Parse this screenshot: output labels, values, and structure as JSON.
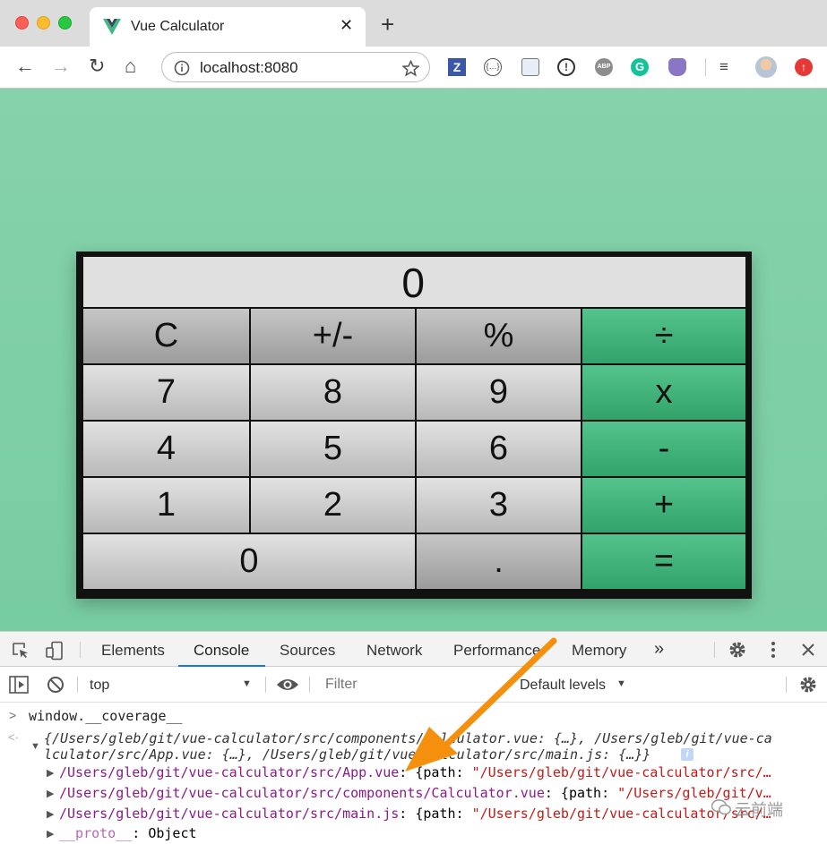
{
  "browser": {
    "tab_title": "Vue Calculator",
    "tab_close": "✕",
    "new_tab": "+",
    "url": "localhost:8080",
    "nav": {
      "back": "←",
      "forward": "→",
      "reload": "↻",
      "home": "⌂"
    },
    "extensions": [
      "z-extension-icon",
      "json-viewer-icon",
      "screenshot-icon",
      "info-icon",
      "adblock-icon",
      "grammarly-icon",
      "cat-extension-icon",
      "playlist-icon",
      "profile-avatar",
      "update-icon"
    ]
  },
  "calculator": {
    "display": "0",
    "rows": [
      [
        "C",
        "+/-",
        "%",
        "÷"
      ],
      [
        "7",
        "8",
        "9",
        "x"
      ],
      [
        "4",
        "5",
        "6",
        "-"
      ],
      [
        "1",
        "2",
        "3",
        "+"
      ],
      [
        "0",
        ".",
        "="
      ]
    ]
  },
  "devtools": {
    "tabs": [
      "Elements",
      "Console",
      "Sources",
      "Network",
      "Performance",
      "Memory"
    ],
    "more": "»",
    "context": "top",
    "filter_placeholder": "Filter",
    "levels": "Default levels",
    "console": {
      "input": "window.__coverage__",
      "summary_line1": "{/Users/gleb/git/vue-calculator/src/components/Calculator.vue: {…}, /Users/gleb/git/vue-ca",
      "summary_line2": "lculator/src/App.vue: {…}, /Users/gleb/git/vue-calculator/src/main.js: {…}}",
      "info_badge": "i",
      "entries": [
        {
          "key": "/Users/gleb/git/vue-calculator/src/App.vue",
          "sep": ": {path: ",
          "value": "\"/Users/gleb/git/vue-calculator/src/…"
        },
        {
          "key": "/Users/gleb/git/vue-calculator/src/components/Calculator.vue",
          "sep": ": {path: ",
          "value": "\"/Users/gleb/git/v…"
        },
        {
          "key": "/Users/gleb/git/vue-calculator/src/main.js",
          "sep": ": {path: ",
          "value": "\"/Users/gleb/git/vue-calculator/src/…"
        }
      ],
      "proto_key": "__proto__",
      "proto_value": ": Object"
    }
  },
  "colors": {
    "accent_green": "#42b883",
    "arrow_orange": "#f5900f",
    "devtools_blue": "#1a73e8"
  },
  "watermark": "云前端"
}
